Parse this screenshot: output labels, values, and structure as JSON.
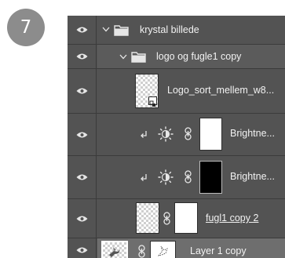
{
  "step_badge": "7",
  "layers": [
    {
      "name": "krystal billede",
      "type": "group",
      "visible": true,
      "expanded": true
    },
    {
      "name": "logo og fugle1 copy",
      "type": "group",
      "visible": true,
      "expanded": true
    },
    {
      "name": "Logo_sort_mellem_w8...",
      "type": "smart-object",
      "visible": true
    },
    {
      "name": "Brightne...",
      "type": "adjustment",
      "visible": true,
      "clipped": true,
      "mask": "white"
    },
    {
      "name": "Brightne...",
      "type": "adjustment",
      "visible": true,
      "clipped": true,
      "mask": "black"
    },
    {
      "name": "fugl1 copy 2",
      "type": "pixel",
      "visible": true,
      "mask": "white"
    },
    {
      "name": "Layer 1 copy",
      "type": "pixel",
      "visible": true,
      "selected": true,
      "mask": "white"
    }
  ],
  "colors": {
    "panel_bg": "#535353",
    "row_selected": "#6e6e6e",
    "row_group": "#5b5b5b",
    "divider": "#3b3b3b",
    "badge": "#8c8c8c"
  }
}
